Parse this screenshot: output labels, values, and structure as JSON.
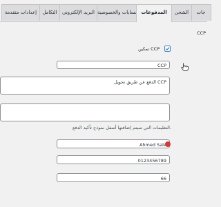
{
  "tabs": [
    {
      "label": "جات"
    },
    {
      "label": "الشحن"
    },
    {
      "label": "المدفوعات",
      "active": true
    },
    {
      "label": "الحسابات والخصوصية"
    },
    {
      "label": "البريد الإلكتروني"
    },
    {
      "label": "التكامل"
    },
    {
      "label": "إعدادات متقدمة"
    }
  ],
  "section": {
    "edge_label": "CCP",
    "enable_label": "تمكين CCP",
    "enable_checked": true
  },
  "fields": {
    "title_value": "CCP",
    "description_value": "الدفع عن طريق تحويل CCP",
    "instructions_value": "",
    "instructions_help": "التعليمات التي سيتم إضافتها أسفل نموذج تأكيد الدفع.",
    "name_value": "Ahmed Sale",
    "account_value": "0123456789",
    "key_value": "66"
  },
  "icons": {
    "cursor": "hand-pointer-icon",
    "field_error": "alert-dot-icon"
  },
  "colors": {
    "accent": "#3582c4",
    "error": "#d63638"
  }
}
